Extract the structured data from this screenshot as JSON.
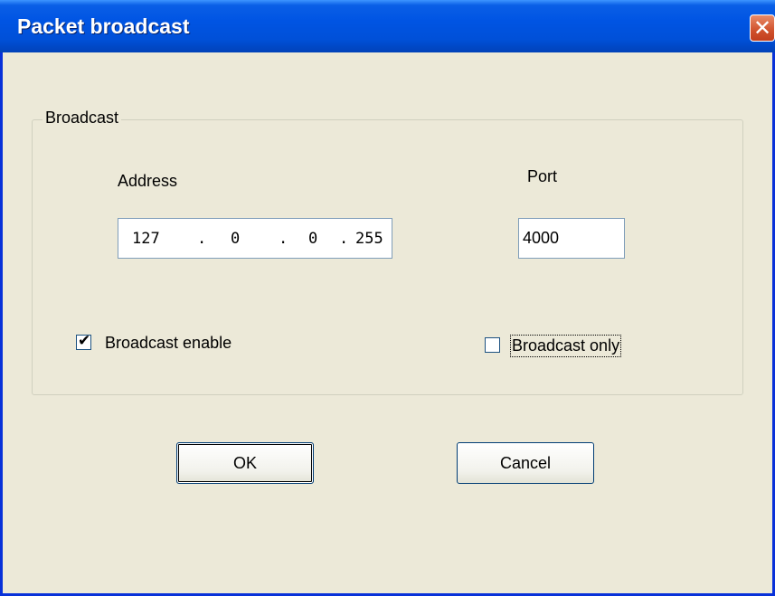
{
  "window": {
    "title": "Packet broadcast"
  },
  "group": {
    "legend": "Broadcast",
    "address_label": "Address",
    "port_label": "Port",
    "ip": [
      "127",
      "0",
      "0",
      "255"
    ],
    "port_value": "4000",
    "broadcast_enable": {
      "label": "Broadcast enable",
      "checked": true
    },
    "broadcast_only": {
      "label": "Broadcast only",
      "checked": false
    }
  },
  "buttons": {
    "ok": "OK",
    "cancel": "Cancel"
  },
  "icons": {
    "close": "close-icon",
    "check": "checkmark-icon"
  },
  "colors": {
    "title_bar": "#0054e3",
    "dialog_bg": "#ece9d8",
    "close_button": "#d0512c"
  }
}
